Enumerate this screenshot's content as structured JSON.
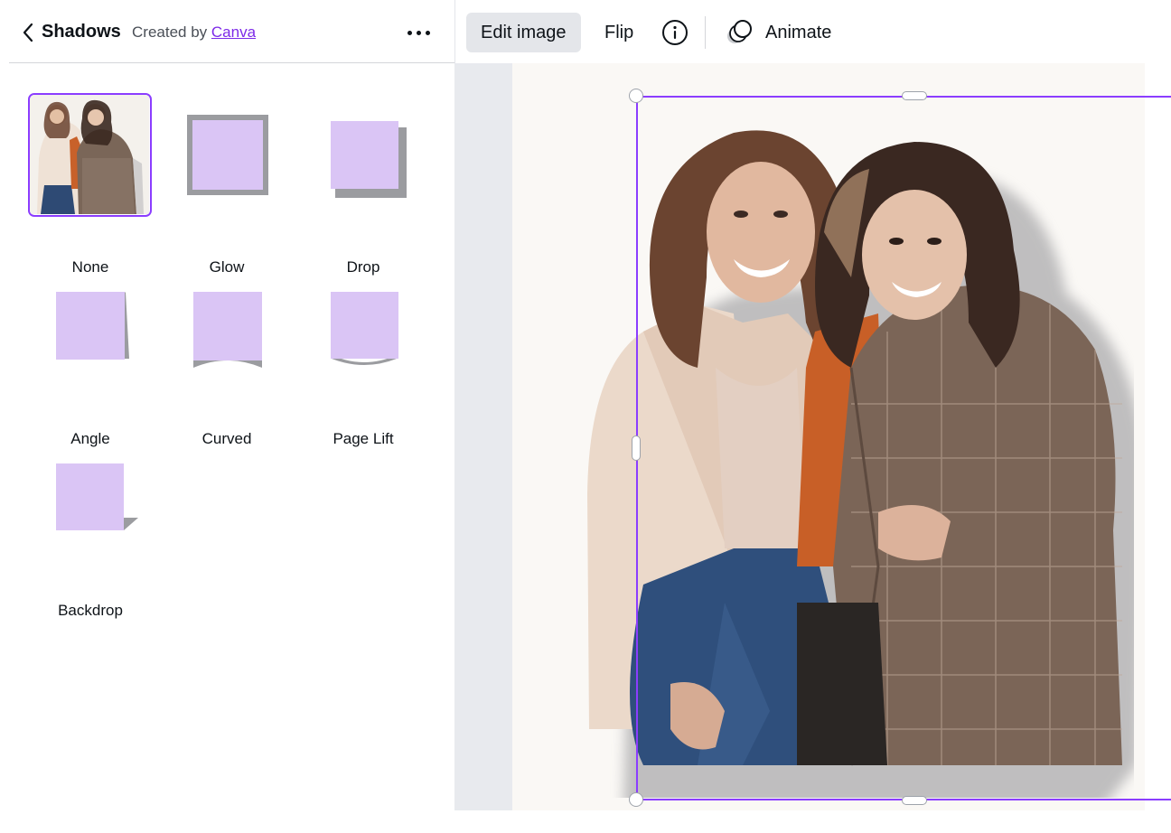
{
  "panel": {
    "title": "Shadows",
    "created_by_prefix": "Created by",
    "created_by_link": "Canva"
  },
  "effects": [
    {
      "label": "None",
      "selected": true
    },
    {
      "label": "Glow",
      "selected": false
    },
    {
      "label": "Drop",
      "selected": false
    },
    {
      "label": "Angle",
      "selected": false
    },
    {
      "label": "Curved",
      "selected": false
    },
    {
      "label": "Page Lift",
      "selected": false
    },
    {
      "label": "Backdrop",
      "selected": false
    }
  ],
  "toolbar": {
    "edit_image": "Edit image",
    "flip": "Flip",
    "animate": "Animate"
  },
  "colors": {
    "accent": "#8b3dff",
    "link": "#7d2ae8",
    "swatch": "#dac5f5",
    "shadow": "#9b9ca0"
  },
  "icons": {
    "back": "chevron-left-icon",
    "more": "more-horizontal-icon",
    "info": "info-icon",
    "animate": "animate-icon"
  }
}
